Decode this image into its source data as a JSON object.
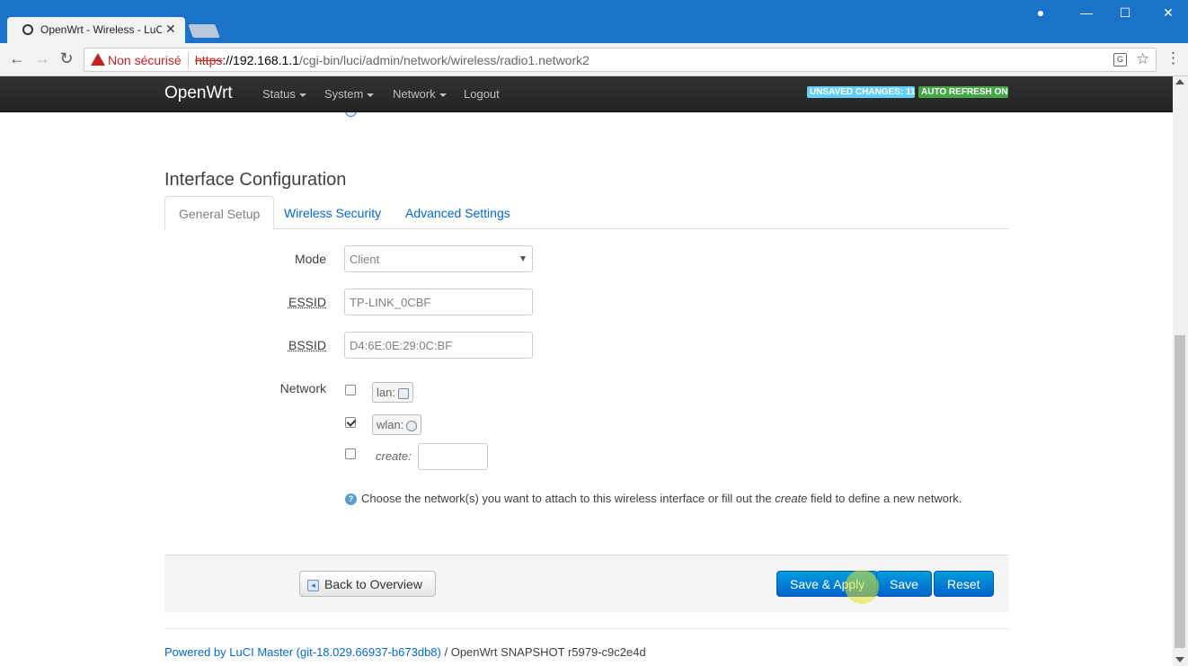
{
  "browser": {
    "tab_title": "OpenWrt - Wireless - LuCI",
    "security_warning": "Non sécurisé",
    "url_scheme": "https",
    "url_host": "://192.168.1.1",
    "url_path": "/cgi-bin/luci/admin/network/wireless/radio1.network2",
    "window_controls": [
      "profile-icon",
      "minimize-icon",
      "maximize-icon",
      "close-icon"
    ]
  },
  "navbar": {
    "brand": "OpenWrt",
    "menu": [
      "Status",
      "System",
      "Network",
      "Logout"
    ],
    "badge_unsaved": "UNSAVED CHANGES: 11",
    "badge_refresh": "AUTO REFRESH ON",
    "badge_unsaved_color": "#62cffc",
    "badge_refresh_color": "#46a546"
  },
  "section": {
    "title": "Interface Configuration",
    "tabs": [
      "General Setup",
      "Wireless Security",
      "Advanced Settings"
    ]
  },
  "form": {
    "mode_label": "Mode",
    "mode_value": "Client",
    "essid_label": "ESSID",
    "essid_value": "TP-LINK_0CBF",
    "bssid_label": "BSSID",
    "bssid_value": "D4:6E:0E:29:0C:BF",
    "network_label": "Network",
    "networks": [
      {
        "name": "lan:",
        "checked": false,
        "icon": "ethernet-icon"
      },
      {
        "name": "wlan:",
        "checked": true,
        "icon": "wifi-icon"
      }
    ],
    "create_label": "create:",
    "help_prefix": "Choose the network(s) you want to attach to this wireless interface or fill out the ",
    "help_em": "create",
    "help_suffix": " field to define a new network."
  },
  "actions": {
    "back": "Back to Overview",
    "save_apply": "Save & Apply",
    "save": "Save",
    "reset": "Reset"
  },
  "footer": {
    "powered": "Powered by LuCI Master (git-18.029.66937-b673db8)",
    "separator": " / ",
    "version": "OpenWrt SNAPSHOT r5979-c9c2e4d"
  }
}
